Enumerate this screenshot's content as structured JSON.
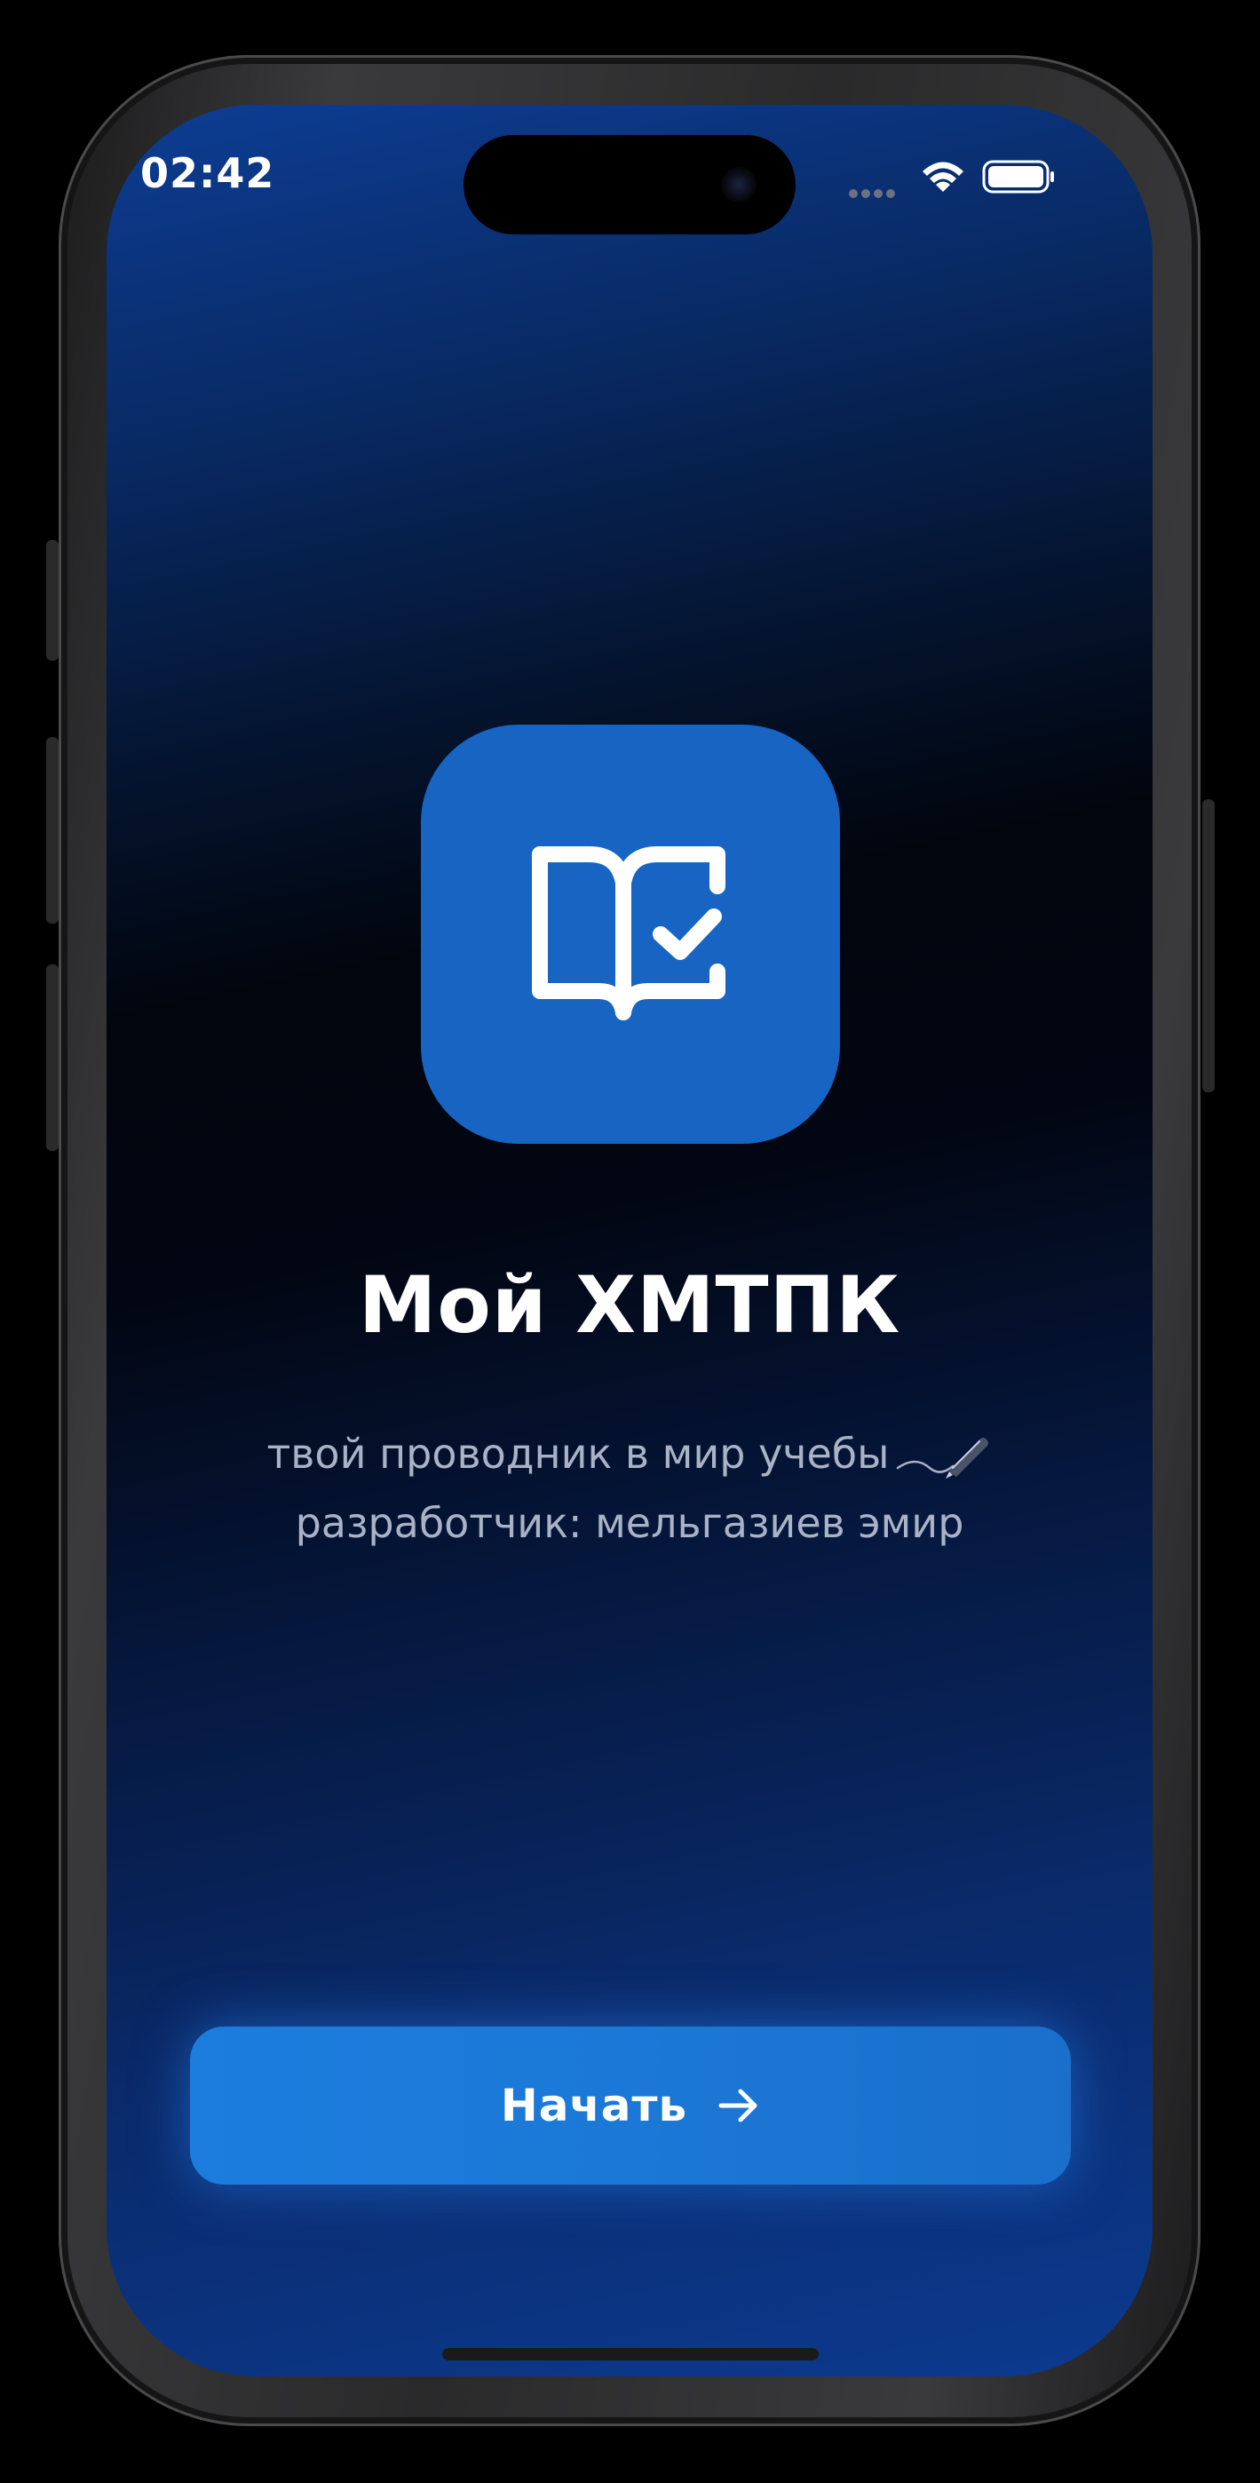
{
  "status_bar": {
    "time": "02:42",
    "icons": [
      "signal-icon",
      "wifi-icon",
      "battery-icon"
    ]
  },
  "app": {
    "logo_icon": "book-check-icon",
    "title": "Мой ХМТПК",
    "subtitle_line1": "твой проводник в мир учебы",
    "subtitle_line1_emoji": "pen-icon",
    "subtitle_line2": "разработчик: мельгазиев эмир"
  },
  "actions": {
    "start_label": "Начать",
    "start_icon": "arrow-right-icon"
  },
  "colors": {
    "accent": "#1C7DDF",
    "icon_bg": "#1764C2",
    "background_top": "#0D3D94",
    "background_mid": "#01050D",
    "subtitle_text": "#A9B2C6"
  }
}
